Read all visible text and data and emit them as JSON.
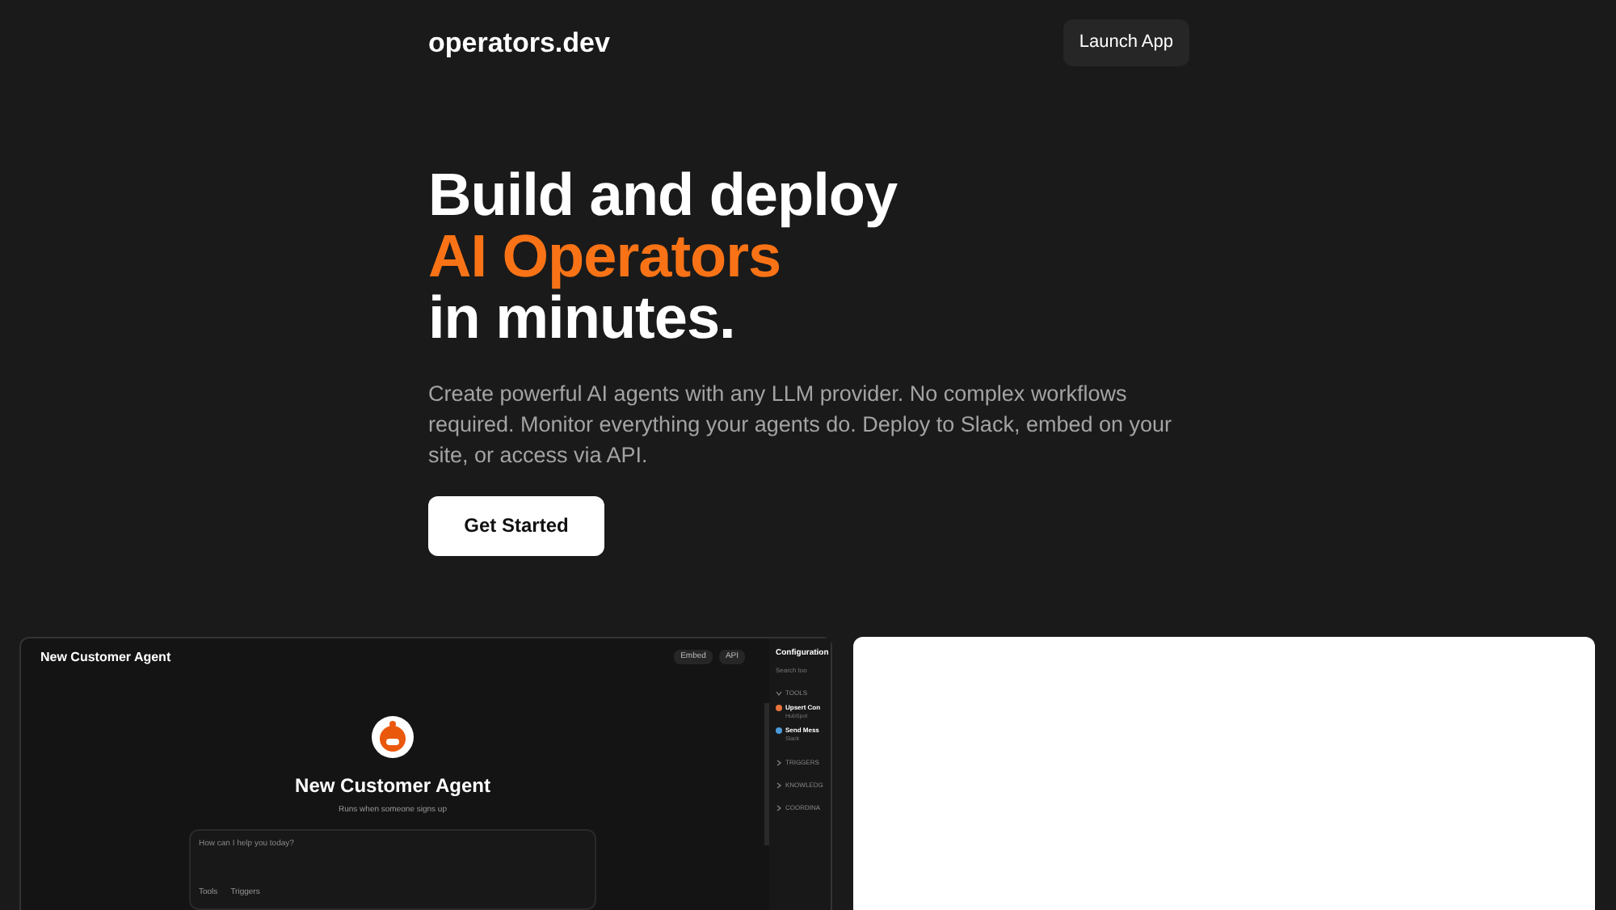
{
  "header": {
    "logo": "operators.dev",
    "button": "Launch App"
  },
  "hero": {
    "title_line_1": "Build and deploy",
    "title_highlight": "AI Operators",
    "title_line_3": "in minutes.",
    "description": "Create powerful AI agents with any LLM provider. No complex workflows required. Monitor everything your agents do. Deploy to Slack, embed on your site, or access via API.",
    "cta": "Get Started"
  },
  "app_preview": {
    "agent_name": "New Customer Agent",
    "actions": [
      "Embed",
      "API"
    ],
    "title": "New Customer Agent",
    "subtitle": "Runs when someone signs up",
    "input_placeholder": "How can I help you today?",
    "input_tools": [
      "Tools",
      "Triggers"
    ],
    "config": {
      "title": "Configuration",
      "search_placeholder": "Search too",
      "sections": [
        {
          "label": "TOOLS",
          "expanded": true,
          "items": [
            {
              "name": "Upsert Con",
              "source": "HubSpot",
              "color": "#e8743b"
            },
            {
              "name": "Send Mess",
              "source": "Slack",
              "color": "#4a9bd9"
            }
          ]
        },
        {
          "label": "TRIGGERS",
          "expanded": false
        },
        {
          "label": "KNOWLEDG",
          "expanded": false
        },
        {
          "label": "COORDINA",
          "expanded": false
        }
      ]
    }
  }
}
